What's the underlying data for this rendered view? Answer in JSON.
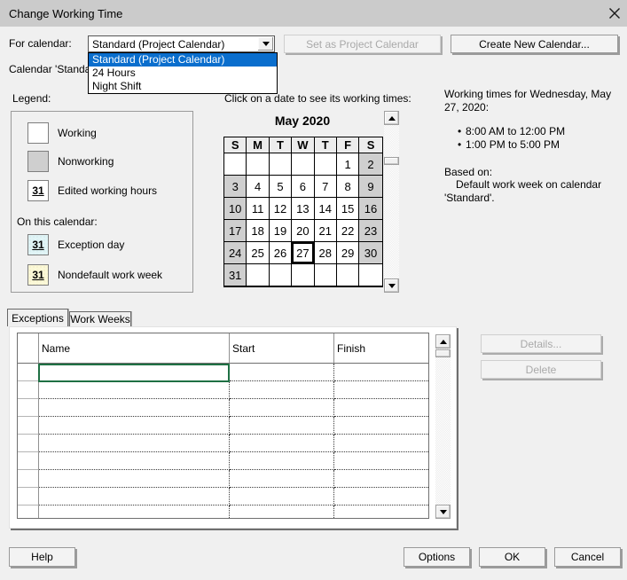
{
  "window": {
    "title": "Change Working Time"
  },
  "colors": {
    "dialog-bg": "#f0f0f0",
    "titlebar-bg": "#cbcbcb",
    "selection-blue": "#0a6ecd",
    "selection-green": "#1f7044",
    "nonworking-fill": "#cfcfcf",
    "exception-fill": "#e1f4f6",
    "nondefault-fill": "#fbf8d8"
  },
  "toolbar": {
    "for_calendar_label": "For calendar:",
    "combobox_value": "Standard (Project Calendar)",
    "dropdown_options": [
      "Standard (Project Calendar)",
      "24 Hours",
      "Night Shift"
    ],
    "selected_option": "Standard (Project Calendar)",
    "set_as_project_calendar_label": "Set as Project Calendar",
    "create_new_calendar_label": "Create New Calendar...",
    "calendar_partial_text": "Calendar 'Standa"
  },
  "legend": {
    "label": "Legend:",
    "items": [
      {
        "label": "Working",
        "swatch_text": ""
      },
      {
        "label": "Nonworking",
        "swatch_text": ""
      },
      {
        "label": "Edited working hours",
        "swatch_text": "31"
      }
    ],
    "on_this_calendar_label": "On this calendar:",
    "calendar_items": [
      {
        "label": "Exception day",
        "swatch_text": "31"
      },
      {
        "label": "Nondefault work week",
        "swatch_text": "31"
      }
    ]
  },
  "calendar": {
    "hint": "Click on a date to see its working times:",
    "month_title": "May 2020",
    "day_headers": [
      "S",
      "M",
      "T",
      "W",
      "T",
      "F",
      "S"
    ],
    "weeks": [
      [
        "",
        "",
        "",
        "",
        "",
        "1",
        "2"
      ],
      [
        "3",
        "4",
        "5",
        "6",
        "7",
        "8",
        "9"
      ],
      [
        "10",
        "11",
        "12",
        "13",
        "14",
        "15",
        "16"
      ],
      [
        "17",
        "18",
        "19",
        "20",
        "21",
        "22",
        "23"
      ],
      [
        "24",
        "25",
        "26",
        "27",
        "28",
        "29",
        "30"
      ],
      [
        "31",
        "",
        "",
        "",
        "",
        "",
        ""
      ]
    ],
    "selected_date": "27",
    "weekend_columns": [
      0,
      6
    ]
  },
  "working_times": {
    "heading": "Working times for Wednesday, May 27, 2020:",
    "times": [
      "8:00 AM to 12:00 PM",
      "1:00 PM to 5:00 PM"
    ],
    "based_on_label": "Based on:",
    "based_on_text": "Default work week on calendar 'Standard'."
  },
  "tabs": [
    {
      "label": "Exceptions",
      "active": true
    },
    {
      "label": "Work Weeks",
      "active": false
    }
  ],
  "exceptions_table": {
    "columns": [
      "Name",
      "Start",
      "Finish"
    ],
    "row_count": 9,
    "rows": [],
    "selected_cell": {
      "row": 0,
      "column": "Name"
    }
  },
  "side_buttons": [
    {
      "label": "Details...",
      "enabled": false
    },
    {
      "label": "Delete",
      "enabled": false
    }
  ],
  "footer_buttons": {
    "help": "Help",
    "options": "Options",
    "ok": "OK",
    "cancel": "Cancel"
  }
}
